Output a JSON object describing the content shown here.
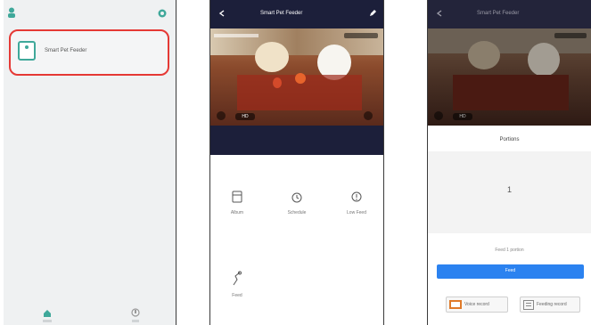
{
  "screen1": {
    "device_card": {
      "label": "Smart Pet Feeder"
    }
  },
  "screen2": {
    "header": {
      "title": "Smart Pet Feeder"
    },
    "video": {
      "overlay_left": "",
      "overlay_right": "",
      "badge": "HD"
    },
    "actions": [
      {
        "label": "Album",
        "icon": "album-icon"
      },
      {
        "label": "Schedule",
        "icon": "schedule-icon"
      },
      {
        "label": "Low Feed",
        "icon": "info-icon"
      }
    ],
    "extra_action": {
      "label": "Feed",
      "icon": "feed-icon"
    }
  },
  "screen3": {
    "header": {
      "title": "Smart Pet Feeder"
    },
    "video": {
      "badge": "HD"
    },
    "panel_title": "Portions",
    "value": "1",
    "hint": "Feed 1 portion",
    "confirm_label": "Feed",
    "chips": [
      {
        "label": "Voice record",
        "icon": "mic-icon"
      },
      {
        "label": "Feeding record",
        "icon": "list-icon"
      }
    ]
  },
  "colors": {
    "dark_header": "#1c1f3a",
    "accent_blue": "#2b82f0",
    "teal": "#3fa89a",
    "red_outline": "#e53935"
  }
}
